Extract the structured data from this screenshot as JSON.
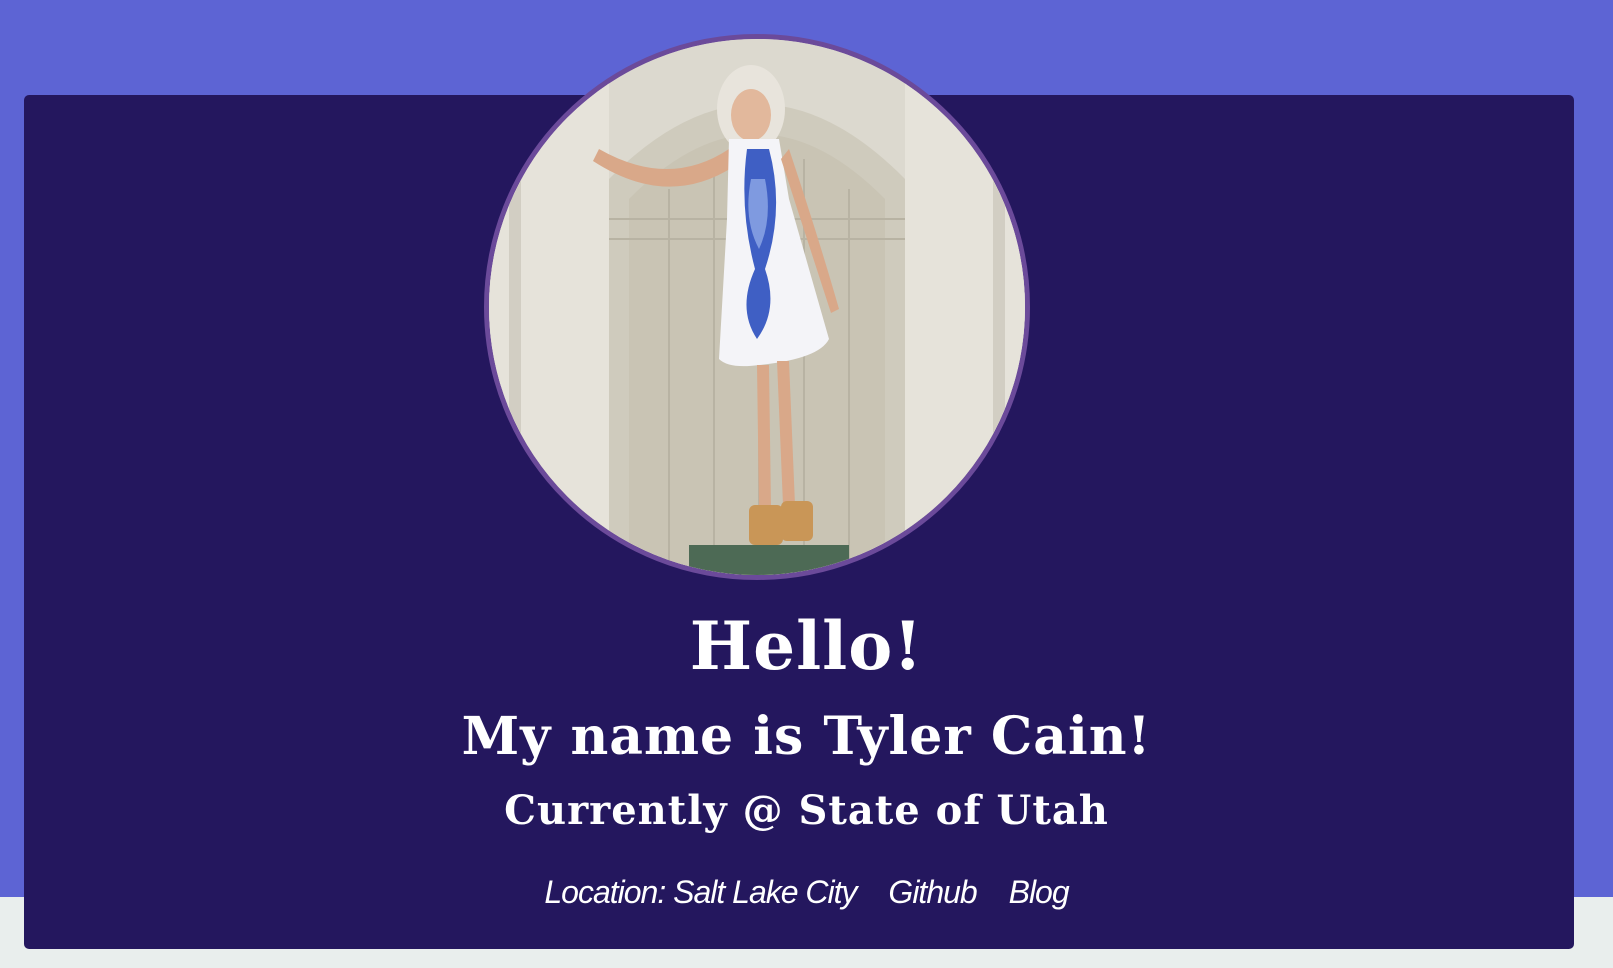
{
  "hero": {
    "greeting": "Hello!",
    "name_line": "My name is Tyler Cain!",
    "current_line": "Currently @ State of Utah"
  },
  "links": {
    "location": "Location: Salt Lake City",
    "github": "Github",
    "blog": "Blog"
  },
  "colors": {
    "page_band": "#5d64d4",
    "card_bg": "#24175e",
    "avatar_border": "#6b4a9a",
    "page_bottom": "#e9eeed",
    "text": "#ffffff"
  },
  "avatar": {
    "icon": "profile-photo"
  }
}
